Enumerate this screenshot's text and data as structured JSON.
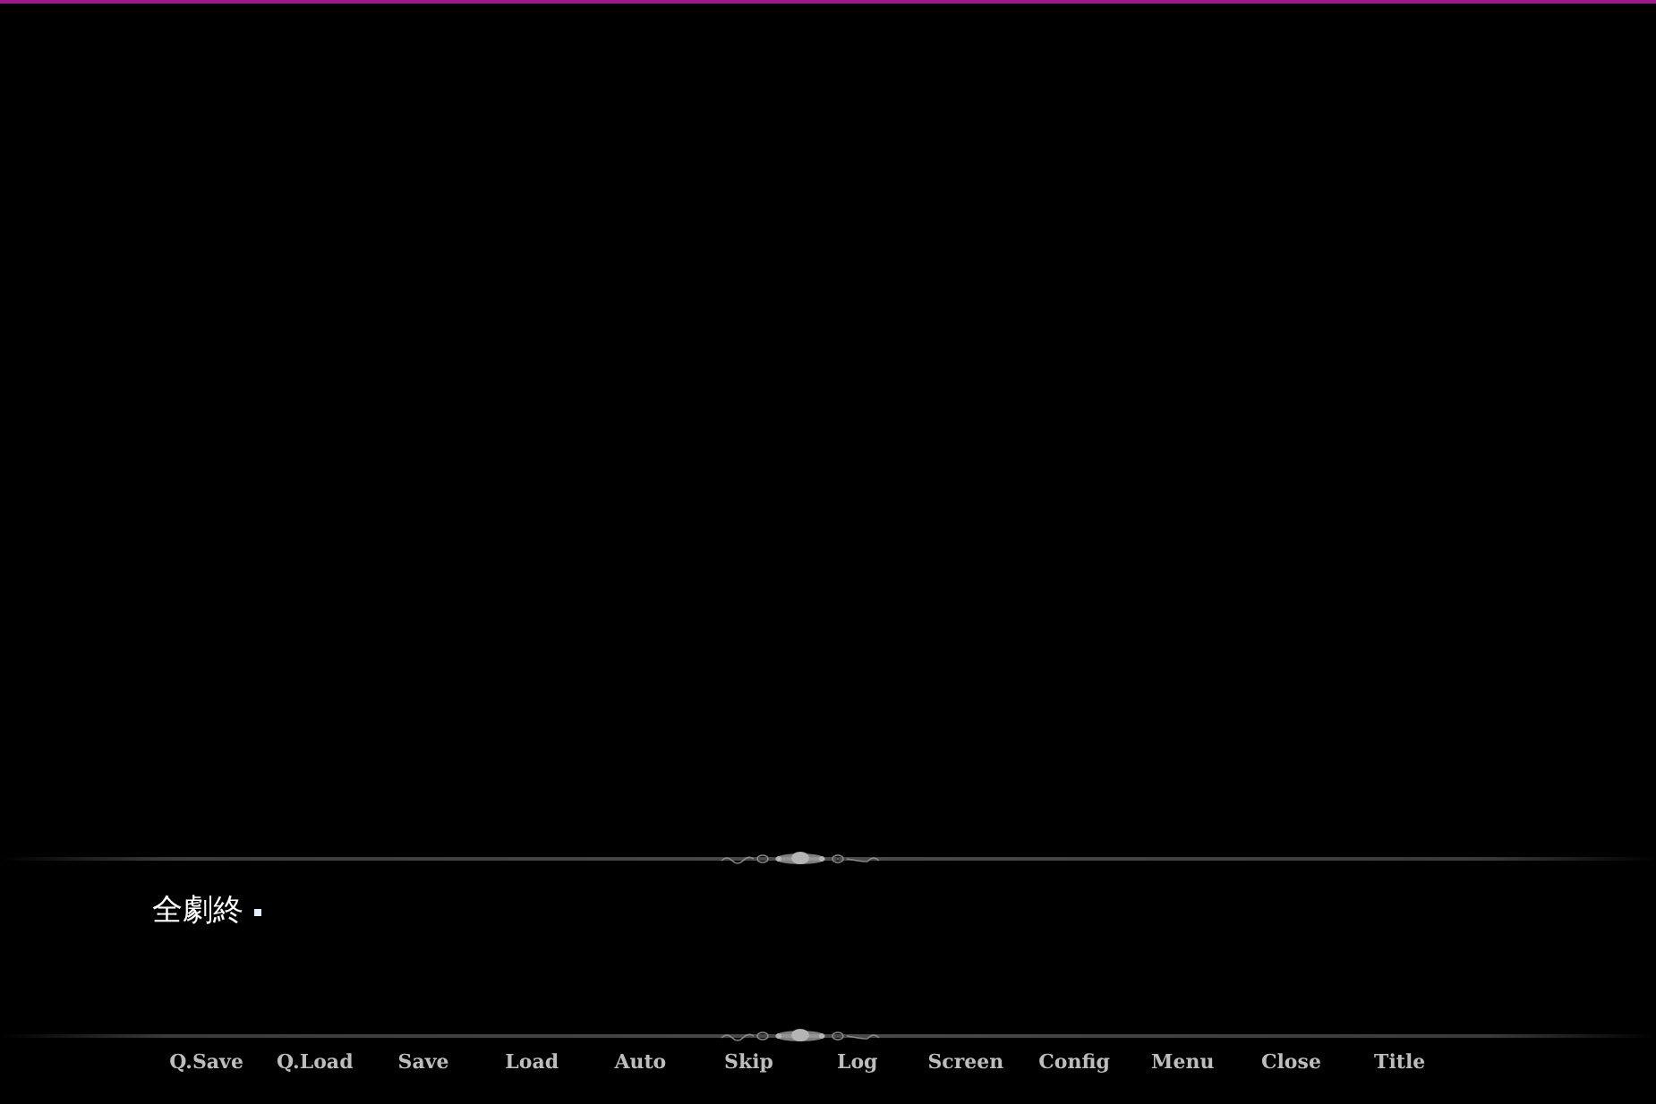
{
  "dialogue": {
    "text": "全劇終"
  },
  "menu_buttons": [
    {
      "label": "Q.Save"
    },
    {
      "label": "Q.Load"
    },
    {
      "label": "Save"
    },
    {
      "label": "Load"
    },
    {
      "label": "Auto"
    },
    {
      "label": "Skip"
    },
    {
      "label": "Log"
    },
    {
      "label": "Screen"
    },
    {
      "label": "Config"
    },
    {
      "label": "Menu"
    },
    {
      "label": "Close"
    },
    {
      "label": "Title"
    }
  ]
}
